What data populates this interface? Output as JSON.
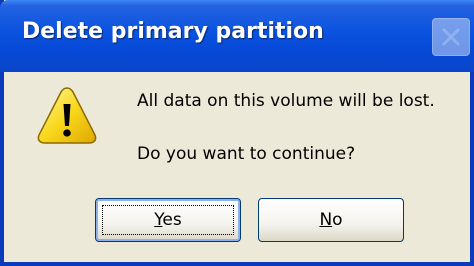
{
  "dialog": {
    "title": "Delete primary partition",
    "message_line1": "All data on this volume will be lost.",
    "message_line2": "Do you want to continue?",
    "icon": "warning-icon"
  },
  "buttons": {
    "yes": {
      "mnemonic": "Y",
      "rest": "es"
    },
    "no": {
      "mnemonic": "N",
      "rest": "o"
    }
  },
  "colors": {
    "titlebar": "#0a52e0",
    "dialog_background": "#ece9d8",
    "warning_yellow": "#f8d81c"
  }
}
